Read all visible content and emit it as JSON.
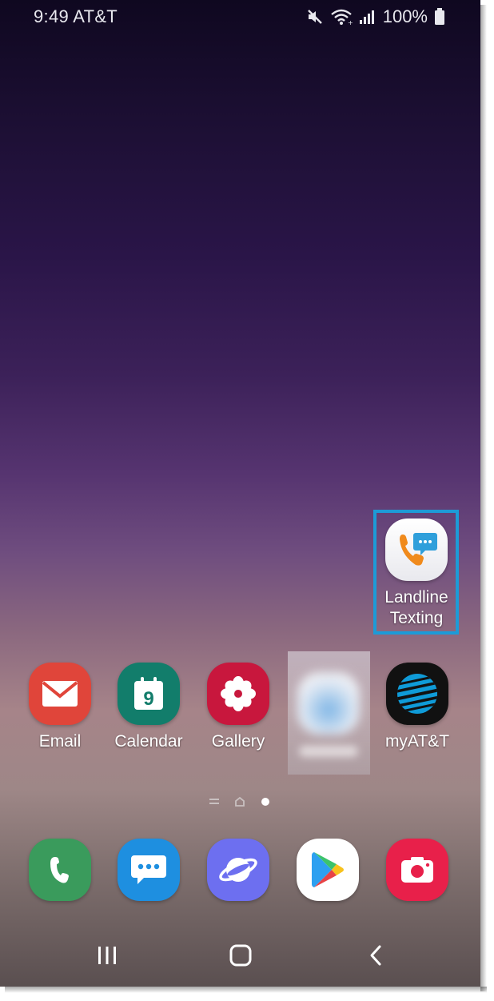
{
  "status_bar": {
    "time": "9:49",
    "carrier": "AT&T",
    "battery": "100%",
    "icons": [
      "mute-icon",
      "wifi-icon",
      "signal-icon",
      "battery-icon"
    ]
  },
  "highlighted_app": {
    "label_line1": "Landline",
    "label_line2": "Texting",
    "icon": "landline-texting-icon",
    "highlight_color": "#1d9bd7"
  },
  "app_row": [
    {
      "label": "Email",
      "icon": "email-icon",
      "color": "#e0453a"
    },
    {
      "label": "Calendar",
      "icon": "calendar-icon",
      "color": "#127d6b",
      "day": "9"
    },
    {
      "label": "Gallery",
      "icon": "gallery-icon",
      "color": "#c8173d"
    },
    {
      "label": "",
      "icon": "blurred-app-icon"
    },
    {
      "label": "myAT&T",
      "icon": "att-icon",
      "color": "#111111"
    }
  ],
  "dock": [
    {
      "icon": "phone-icon",
      "color": "#3a9b5c"
    },
    {
      "icon": "messages-icon",
      "color": "#1e8fe0"
    },
    {
      "icon": "internet-icon",
      "color": "#6d6ff0"
    },
    {
      "icon": "play-store-icon",
      "color": "#ffffff"
    },
    {
      "icon": "camera-icon",
      "color": "#e8204a"
    }
  ],
  "page_indicators": [
    "list-indicator",
    "home-indicator",
    "active-page-dot"
  ],
  "nav": [
    "recents-button",
    "home-button",
    "back-button"
  ]
}
